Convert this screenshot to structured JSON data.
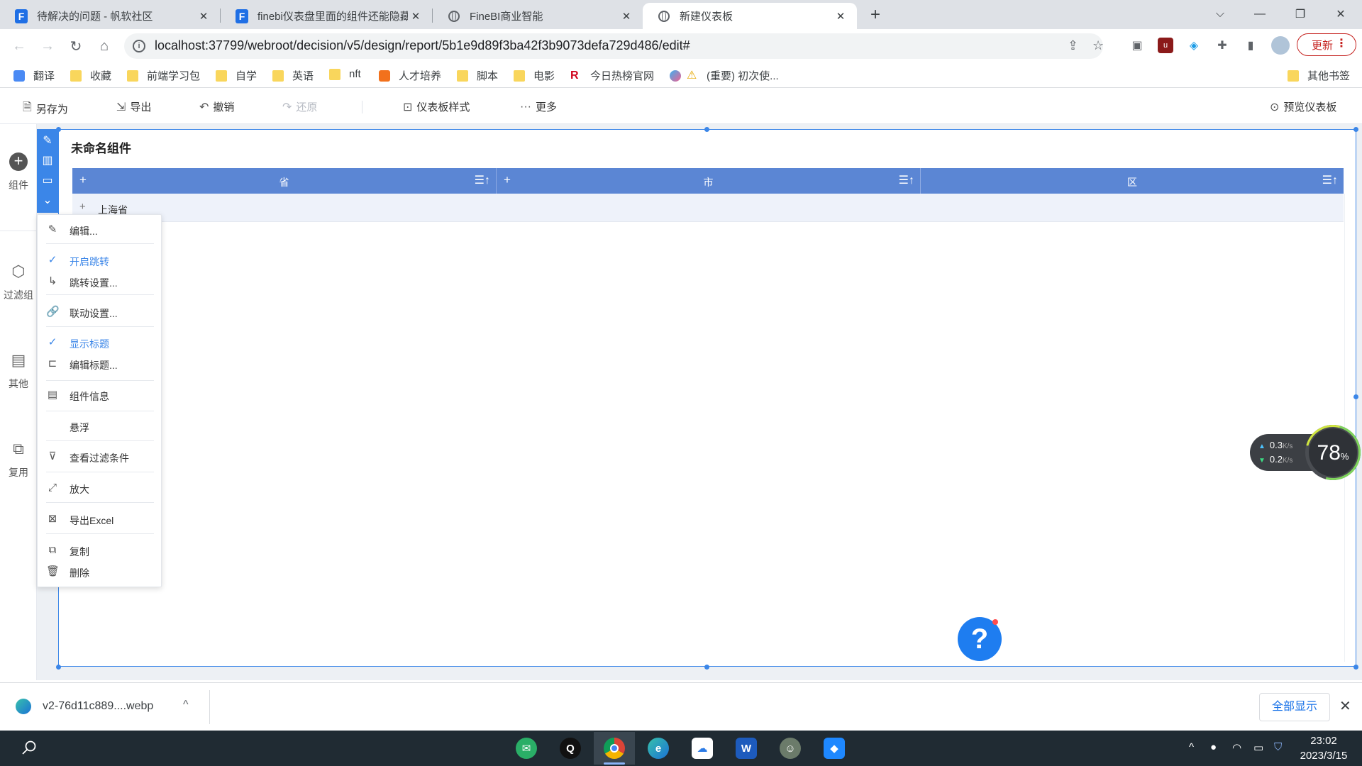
{
  "browser": {
    "tabs": [
      {
        "title": "待解决的问题 - 帆软社区",
        "icon": "fanruan-logo-icon"
      },
      {
        "title": "finebi仪表盘里面的组件还能隐藏",
        "icon": "fanruan-logo-icon"
      },
      {
        "title": "FineBI商业智能",
        "icon": "globe-icon"
      },
      {
        "title": "新建仪表板",
        "icon": "globe-icon",
        "active": true
      }
    ],
    "url": "localhost:37799/webroot/decision/v5/design/report/5b1e9d89f3ba42f3b9073defa729d486/edit#",
    "update_label": "更新",
    "bookmarks": [
      {
        "label": "翻译",
        "icon": "translate-icon"
      },
      {
        "label": "收藏",
        "icon": "folder-icon"
      },
      {
        "label": "前端学习包",
        "icon": "folder-icon"
      },
      {
        "label": "自学",
        "icon": "folder-icon"
      },
      {
        "label": "英语",
        "icon": "folder-icon"
      },
      {
        "label": "nft",
        "icon": "folder-icon"
      },
      {
        "label": "人才培养",
        "icon": "cloud-icon"
      },
      {
        "label": "脚本",
        "icon": "folder-icon"
      },
      {
        "label": "电影",
        "icon": "folder-icon"
      },
      {
        "label": "今日热榜官网",
        "icon": "r-logo-icon"
      },
      {
        "label": "(重要) 初次使...",
        "icon": "warning-icon"
      }
    ],
    "other_bookmarks": "其他书签"
  },
  "app_toolbar": {
    "save_as": "另存为",
    "export": "导出",
    "undo": "撤销",
    "redo": "还原",
    "dashboard_style": "仪表板样式",
    "more": "更多",
    "preview": "预览仪表板"
  },
  "left_panel": {
    "items": [
      {
        "label": "组件",
        "icon": "add-circle-icon"
      },
      {
        "label": "过滤组",
        "icon": "cube-icon"
      },
      {
        "label": "其他",
        "icon": "text-doc-icon"
      },
      {
        "label": "复用",
        "icon": "copy-layers-icon"
      }
    ]
  },
  "widget": {
    "title": "未命名组件",
    "columns": [
      "省",
      "市",
      "区"
    ],
    "rows": [
      [
        "上海省",
        "",
        ""
      ]
    ]
  },
  "context_menu": {
    "items": [
      {
        "label": "编辑...",
        "icon": "edit-icon",
        "checked": false
      },
      {
        "label": "开启跳转",
        "icon": "check-icon",
        "checked": true
      },
      {
        "label": "跳转设置...",
        "icon": "jump-arrow-icon",
        "checked": false
      },
      {
        "label": "联动设置...",
        "icon": "link-icon",
        "checked": false
      },
      {
        "label": "显示标题",
        "icon": "check-icon",
        "checked": true
      },
      {
        "label": "编辑标题...",
        "icon": "edit-title-icon",
        "checked": false
      },
      {
        "label": "组件信息",
        "icon": "info-doc-icon",
        "checked": false
      },
      {
        "label": "悬浮",
        "icon": "",
        "checked": false
      },
      {
        "label": "查看过滤条件",
        "icon": "filter-icon",
        "checked": false
      },
      {
        "label": "放大",
        "icon": "expand-icon",
        "checked": false
      },
      {
        "label": "导出Excel",
        "icon": "excel-icon",
        "checked": false
      },
      {
        "label": "复制",
        "icon": "copy-icon",
        "checked": false
      },
      {
        "label": "删除",
        "icon": "trash-icon",
        "checked": false
      }
    ]
  },
  "help_label": "?",
  "speed_widget": {
    "up": "0.3",
    "down": "0.2",
    "unit": "K/s",
    "percent": "78",
    "percent_unit": "%"
  },
  "download_bar": {
    "file": "v2-76d11c889....webp",
    "show_all": "全部显示"
  },
  "taskbar": {
    "time": "23:02",
    "date": "2023/3/15",
    "apps": [
      "wechat-icon",
      "qq-icon",
      "chrome-icon",
      "edge-icon",
      "baidu-netdisk-icon",
      "word-icon",
      "avatar-app-icon",
      "feishu-icon"
    ]
  },
  "colors": {
    "accent": "#3b86e8",
    "table_header": "#5b86d4",
    "update_red": "#c5221f"
  }
}
